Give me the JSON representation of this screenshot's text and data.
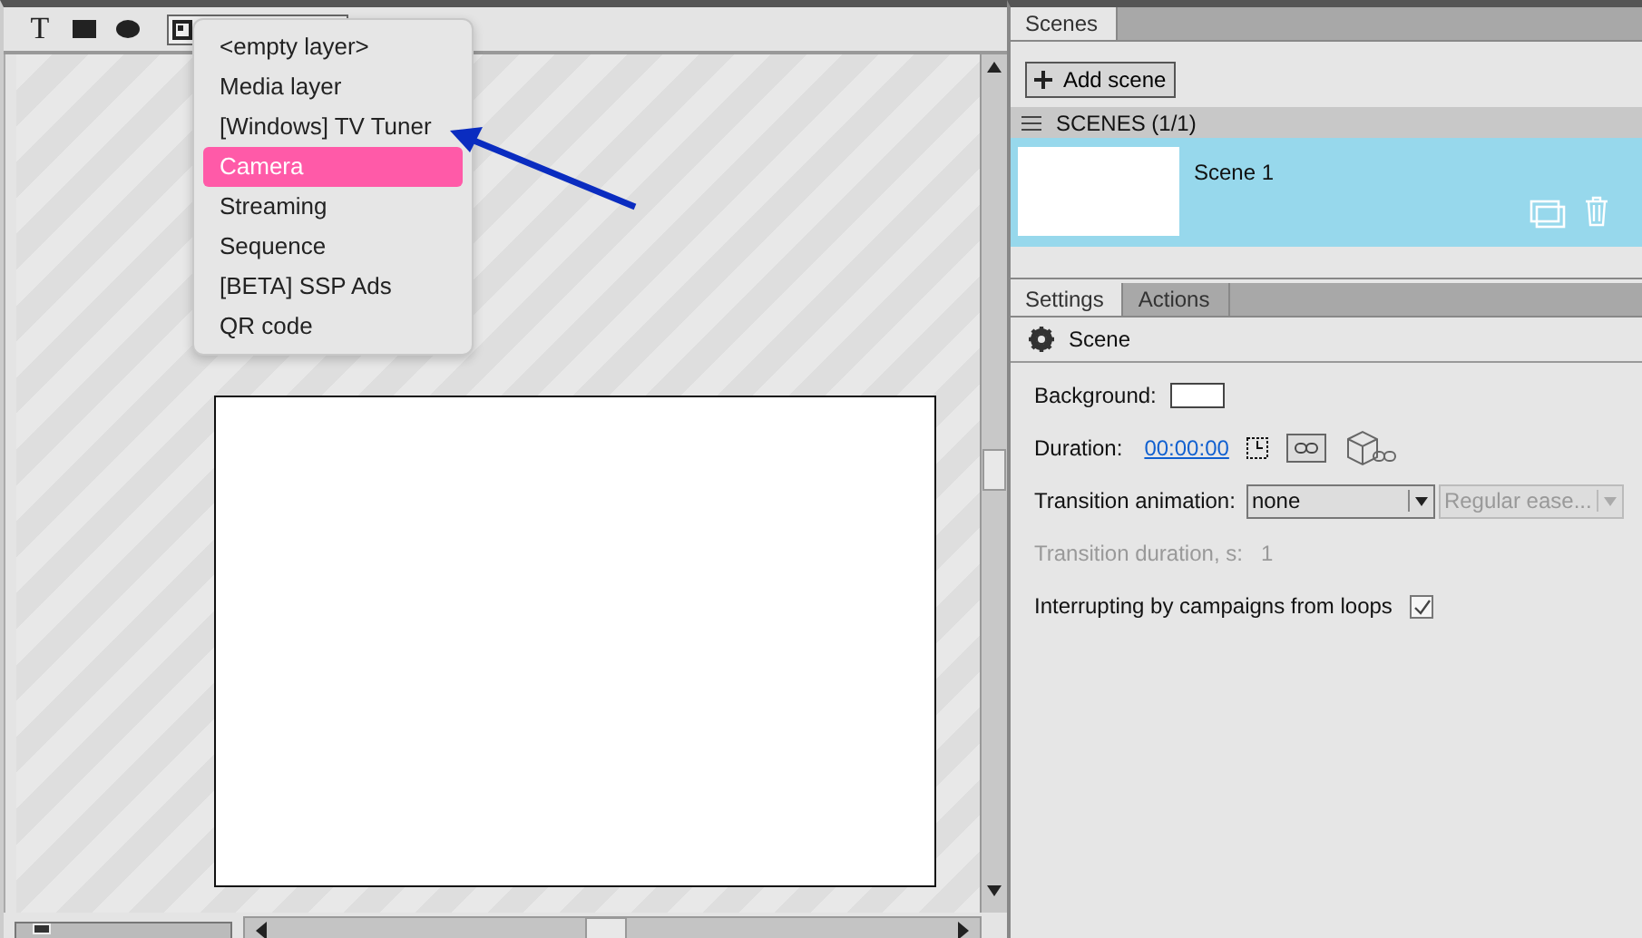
{
  "toolbar": {
    "tools": [
      {
        "kind": "text",
        "label": "T",
        "selected": false
      },
      {
        "kind": "rect",
        "selected": false
      },
      {
        "kind": "ellipse",
        "selected": false
      },
      {
        "kind": "layer",
        "selected": true
      }
    ]
  },
  "layer_menu": {
    "items": [
      {
        "label": "<empty layer>",
        "selected": false
      },
      {
        "label": "Media layer",
        "selected": false
      },
      {
        "label": "[Windows] TV Tuner",
        "selected": false
      },
      {
        "label": "Camera",
        "selected": true
      },
      {
        "label": "Streaming",
        "selected": false
      },
      {
        "label": "Sequence",
        "selected": false
      },
      {
        "label": "[BETA] SSP Ads",
        "selected": false
      },
      {
        "label": "QR code",
        "selected": false
      }
    ]
  },
  "zoom_slider": {
    "level": 0.08
  },
  "scenes_panel": {
    "tabs": [
      {
        "label": "Scenes",
        "selected": true
      }
    ],
    "add_button": "Add scene",
    "header": "SCENES (1/1)",
    "scenes": [
      {
        "name": "Scene 1",
        "selected": true
      }
    ]
  },
  "settings_panel": {
    "tabs": [
      {
        "label": "Settings",
        "selected": true
      },
      {
        "label": "Actions",
        "selected": false
      }
    ],
    "title": "Scene",
    "background_label": "Background:",
    "duration_label": "Duration:",
    "duration_value": "00:00:00",
    "transition_label": "Transition animation:",
    "transition_value": "none",
    "easing_value": "Regular ease...",
    "transition_duration_label": "Transition duration, s:",
    "transition_duration_value": "1",
    "transition_duration_disabled": true,
    "interrupt_label": "Interrupting by campaigns from loops",
    "interrupt_checked": true
  }
}
